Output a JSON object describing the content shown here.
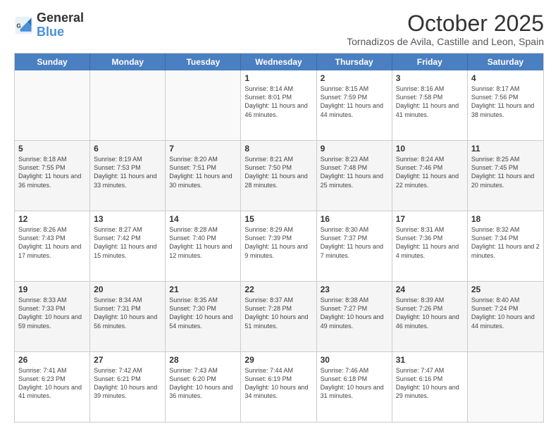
{
  "header": {
    "logo_general": "General",
    "logo_blue": "Blue",
    "month": "October 2025",
    "location": "Tornadizos de Avila, Castille and Leon, Spain"
  },
  "weekdays": [
    "Sunday",
    "Monday",
    "Tuesday",
    "Wednesday",
    "Thursday",
    "Friday",
    "Saturday"
  ],
  "rows": [
    [
      {
        "day": "",
        "info": "",
        "empty": true
      },
      {
        "day": "",
        "info": "",
        "empty": true
      },
      {
        "day": "",
        "info": "",
        "empty": true
      },
      {
        "day": "1",
        "info": "Sunrise: 8:14 AM\nSunset: 8:01 PM\nDaylight: 11 hours\nand 46 minutes."
      },
      {
        "day": "2",
        "info": "Sunrise: 8:15 AM\nSunset: 7:59 PM\nDaylight: 11 hours\nand 44 minutes."
      },
      {
        "day": "3",
        "info": "Sunrise: 8:16 AM\nSunset: 7:58 PM\nDaylight: 11 hours\nand 41 minutes."
      },
      {
        "day": "4",
        "info": "Sunrise: 8:17 AM\nSunset: 7:56 PM\nDaylight: 11 hours\nand 38 minutes."
      }
    ],
    [
      {
        "day": "5",
        "info": "Sunrise: 8:18 AM\nSunset: 7:55 PM\nDaylight: 11 hours\nand 36 minutes."
      },
      {
        "day": "6",
        "info": "Sunrise: 8:19 AM\nSunset: 7:53 PM\nDaylight: 11 hours\nand 33 minutes."
      },
      {
        "day": "7",
        "info": "Sunrise: 8:20 AM\nSunset: 7:51 PM\nDaylight: 11 hours\nand 30 minutes."
      },
      {
        "day": "8",
        "info": "Sunrise: 8:21 AM\nSunset: 7:50 PM\nDaylight: 11 hours\nand 28 minutes."
      },
      {
        "day": "9",
        "info": "Sunrise: 8:23 AM\nSunset: 7:48 PM\nDaylight: 11 hours\nand 25 minutes."
      },
      {
        "day": "10",
        "info": "Sunrise: 8:24 AM\nSunset: 7:46 PM\nDaylight: 11 hours\nand 22 minutes."
      },
      {
        "day": "11",
        "info": "Sunrise: 8:25 AM\nSunset: 7:45 PM\nDaylight: 11 hours\nand 20 minutes."
      }
    ],
    [
      {
        "day": "12",
        "info": "Sunrise: 8:26 AM\nSunset: 7:43 PM\nDaylight: 11 hours\nand 17 minutes."
      },
      {
        "day": "13",
        "info": "Sunrise: 8:27 AM\nSunset: 7:42 PM\nDaylight: 11 hours\nand 15 minutes."
      },
      {
        "day": "14",
        "info": "Sunrise: 8:28 AM\nSunset: 7:40 PM\nDaylight: 11 hours\nand 12 minutes."
      },
      {
        "day": "15",
        "info": "Sunrise: 8:29 AM\nSunset: 7:39 PM\nDaylight: 11 hours\nand 9 minutes."
      },
      {
        "day": "16",
        "info": "Sunrise: 8:30 AM\nSunset: 7:37 PM\nDaylight: 11 hours\nand 7 minutes."
      },
      {
        "day": "17",
        "info": "Sunrise: 8:31 AM\nSunset: 7:36 PM\nDaylight: 11 hours\nand 4 minutes."
      },
      {
        "day": "18",
        "info": "Sunrise: 8:32 AM\nSunset: 7:34 PM\nDaylight: 11 hours\nand 2 minutes."
      }
    ],
    [
      {
        "day": "19",
        "info": "Sunrise: 8:33 AM\nSunset: 7:33 PM\nDaylight: 10 hours\nand 59 minutes."
      },
      {
        "day": "20",
        "info": "Sunrise: 8:34 AM\nSunset: 7:31 PM\nDaylight: 10 hours\nand 56 minutes."
      },
      {
        "day": "21",
        "info": "Sunrise: 8:35 AM\nSunset: 7:30 PM\nDaylight: 10 hours\nand 54 minutes."
      },
      {
        "day": "22",
        "info": "Sunrise: 8:37 AM\nSunset: 7:28 PM\nDaylight: 10 hours\nand 51 minutes."
      },
      {
        "day": "23",
        "info": "Sunrise: 8:38 AM\nSunset: 7:27 PM\nDaylight: 10 hours\nand 49 minutes."
      },
      {
        "day": "24",
        "info": "Sunrise: 8:39 AM\nSunset: 7:26 PM\nDaylight: 10 hours\nand 46 minutes."
      },
      {
        "day": "25",
        "info": "Sunrise: 8:40 AM\nSunset: 7:24 PM\nDaylight: 10 hours\nand 44 minutes."
      }
    ],
    [
      {
        "day": "26",
        "info": "Sunrise: 7:41 AM\nSunset: 6:23 PM\nDaylight: 10 hours\nand 41 minutes."
      },
      {
        "day": "27",
        "info": "Sunrise: 7:42 AM\nSunset: 6:21 PM\nDaylight: 10 hours\nand 39 minutes."
      },
      {
        "day": "28",
        "info": "Sunrise: 7:43 AM\nSunset: 6:20 PM\nDaylight: 10 hours\nand 36 minutes."
      },
      {
        "day": "29",
        "info": "Sunrise: 7:44 AM\nSunset: 6:19 PM\nDaylight: 10 hours\nand 34 minutes."
      },
      {
        "day": "30",
        "info": "Sunrise: 7:46 AM\nSunset: 6:18 PM\nDaylight: 10 hours\nand 31 minutes."
      },
      {
        "day": "31",
        "info": "Sunrise: 7:47 AM\nSunset: 6:16 PM\nDaylight: 10 hours\nand 29 minutes."
      },
      {
        "day": "",
        "info": "",
        "empty": true
      }
    ]
  ],
  "colors": {
    "header_bg": "#4a7fc1",
    "alt_row_bg": "#f5f5f5",
    "empty_bg": "#f9f9f9"
  }
}
